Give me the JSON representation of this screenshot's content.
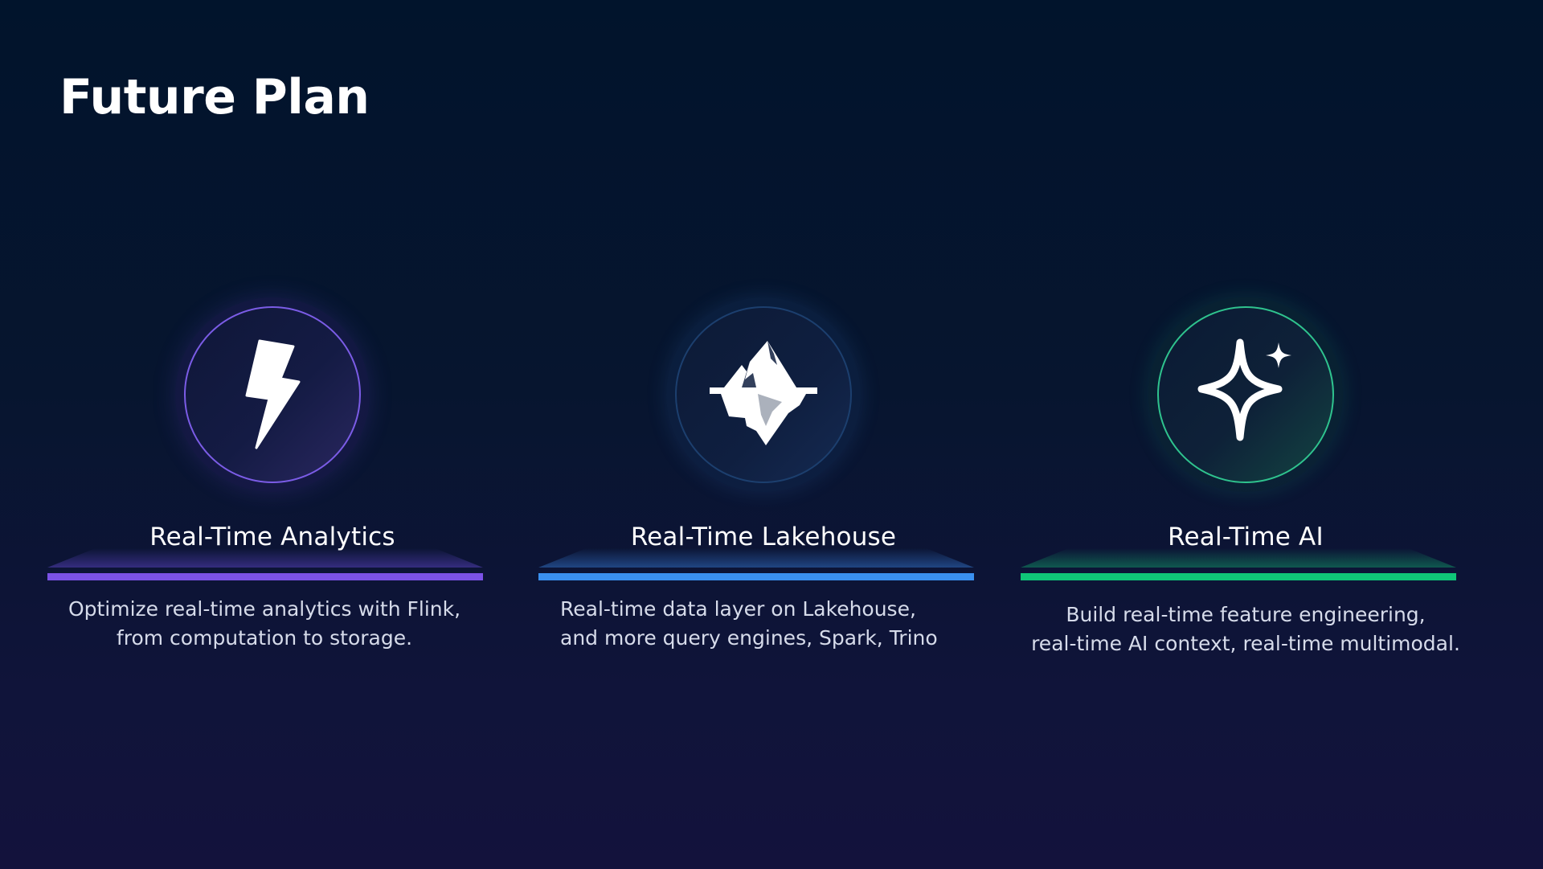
{
  "slide": {
    "title": "Future Plan"
  },
  "pillars": [
    {
      "label": "Real-Time Analytics",
      "icon": "lightning-bolt-icon",
      "accent": "#7b52e6",
      "description": [
        "Optimize real-time analytics with Flink,",
        "from computation to storage."
      ]
    },
    {
      "label": "Real-Time Lakehouse",
      "icon": "iceberg-icon",
      "accent": "#3a90f0",
      "description": [
        "Real-time data layer on Lakehouse,",
        "and more query engines, Spark, Trino"
      ]
    },
    {
      "label": "Real-Time AI",
      "icon": "sparkle-icon",
      "accent": "#0fc678",
      "description": [
        "Build real-time feature engineering,",
        "real-time AI context, real-time multimodal."
      ]
    }
  ]
}
